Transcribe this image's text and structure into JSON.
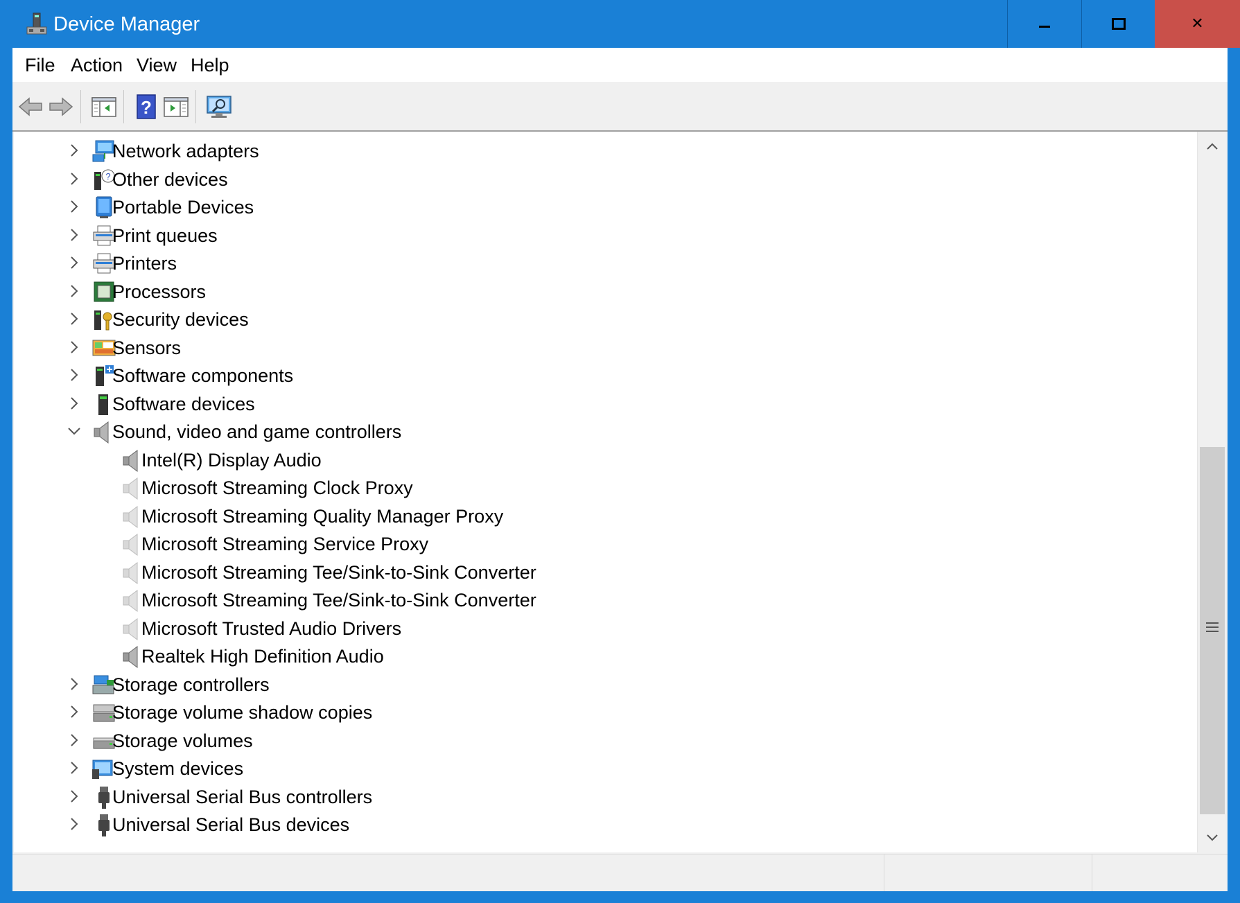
{
  "window": {
    "title": "Device Manager",
    "accent_color": "#1a80d6",
    "close_color": "#c9504a",
    "controls": {
      "minimize_icon": "minimize-icon",
      "maximize_icon": "maximize-icon",
      "close_label": "✕"
    }
  },
  "menubar": {
    "items": [
      {
        "label": "File"
      },
      {
        "label": "Action"
      },
      {
        "label": "View"
      },
      {
        "label": "Help"
      }
    ]
  },
  "toolbar": {
    "buttons": [
      {
        "icon": "back-arrow-icon"
      },
      {
        "icon": "forward-arrow-icon"
      },
      {
        "icon": "show-hide-console-tree-icon"
      },
      {
        "icon": "help-icon"
      },
      {
        "icon": "properties-pane-icon"
      },
      {
        "icon": "scan-hardware-icon"
      }
    ]
  },
  "tree": {
    "nodes": [
      {
        "label": "Network adapters",
        "icon": "network-adapter-icon",
        "expanded": false,
        "level": 0
      },
      {
        "label": "Other devices",
        "icon": "other-devices-icon",
        "expanded": false,
        "level": 0
      },
      {
        "label": "Portable Devices",
        "icon": "portable-device-icon",
        "expanded": false,
        "level": 0
      },
      {
        "label": "Print queues",
        "icon": "print-queue-icon",
        "expanded": false,
        "level": 0
      },
      {
        "label": "Printers",
        "icon": "printer-icon",
        "expanded": false,
        "level": 0
      },
      {
        "label": "Processors",
        "icon": "processor-icon",
        "expanded": false,
        "level": 0
      },
      {
        "label": "Security devices",
        "icon": "security-device-icon",
        "expanded": false,
        "level": 0
      },
      {
        "label": "Sensors",
        "icon": "sensor-icon",
        "expanded": false,
        "level": 0
      },
      {
        "label": "Software components",
        "icon": "software-component-icon",
        "expanded": false,
        "level": 0
      },
      {
        "label": "Software devices",
        "icon": "software-device-icon",
        "expanded": false,
        "level": 0
      },
      {
        "label": "Sound, video and game controllers",
        "icon": "speaker-icon",
        "expanded": true,
        "level": 0
      },
      {
        "label": "Intel(R) Display Audio",
        "icon": "speaker-icon",
        "level": 1
      },
      {
        "label": "Microsoft Streaming Clock Proxy",
        "icon": "speaker-faded-icon",
        "level": 1
      },
      {
        "label": "Microsoft Streaming Quality Manager Proxy",
        "icon": "speaker-faded-icon",
        "level": 1
      },
      {
        "label": "Microsoft Streaming Service Proxy",
        "icon": "speaker-faded-icon",
        "level": 1
      },
      {
        "label": "Microsoft Streaming Tee/Sink-to-Sink Converter",
        "icon": "speaker-faded-icon",
        "level": 1
      },
      {
        "label": "Microsoft Streaming Tee/Sink-to-Sink Converter",
        "icon": "speaker-faded-icon",
        "level": 1
      },
      {
        "label": "Microsoft Trusted Audio Drivers",
        "icon": "speaker-faded-icon",
        "level": 1
      },
      {
        "label": "Realtek High Definition Audio",
        "icon": "speaker-icon",
        "level": 1
      },
      {
        "label": "Storage controllers",
        "icon": "storage-controller-icon",
        "expanded": false,
        "level": 0
      },
      {
        "label": "Storage volume shadow copies",
        "icon": "shadow-copy-icon",
        "expanded": false,
        "level": 0
      },
      {
        "label": "Storage volumes",
        "icon": "storage-volume-icon",
        "expanded": false,
        "level": 0
      },
      {
        "label": "System devices",
        "icon": "system-device-icon",
        "expanded": false,
        "level": 0
      },
      {
        "label": "Universal Serial Bus controllers",
        "icon": "usb-icon",
        "expanded": false,
        "level": 0
      },
      {
        "label": "Universal Serial Bus devices",
        "icon": "usb-icon",
        "expanded": false,
        "level": 0
      }
    ]
  },
  "scrollbar": {
    "up_icon": "chevron-up-icon",
    "down_icon": "chevron-down-icon",
    "grip_icon": "scroll-grip-icon"
  }
}
